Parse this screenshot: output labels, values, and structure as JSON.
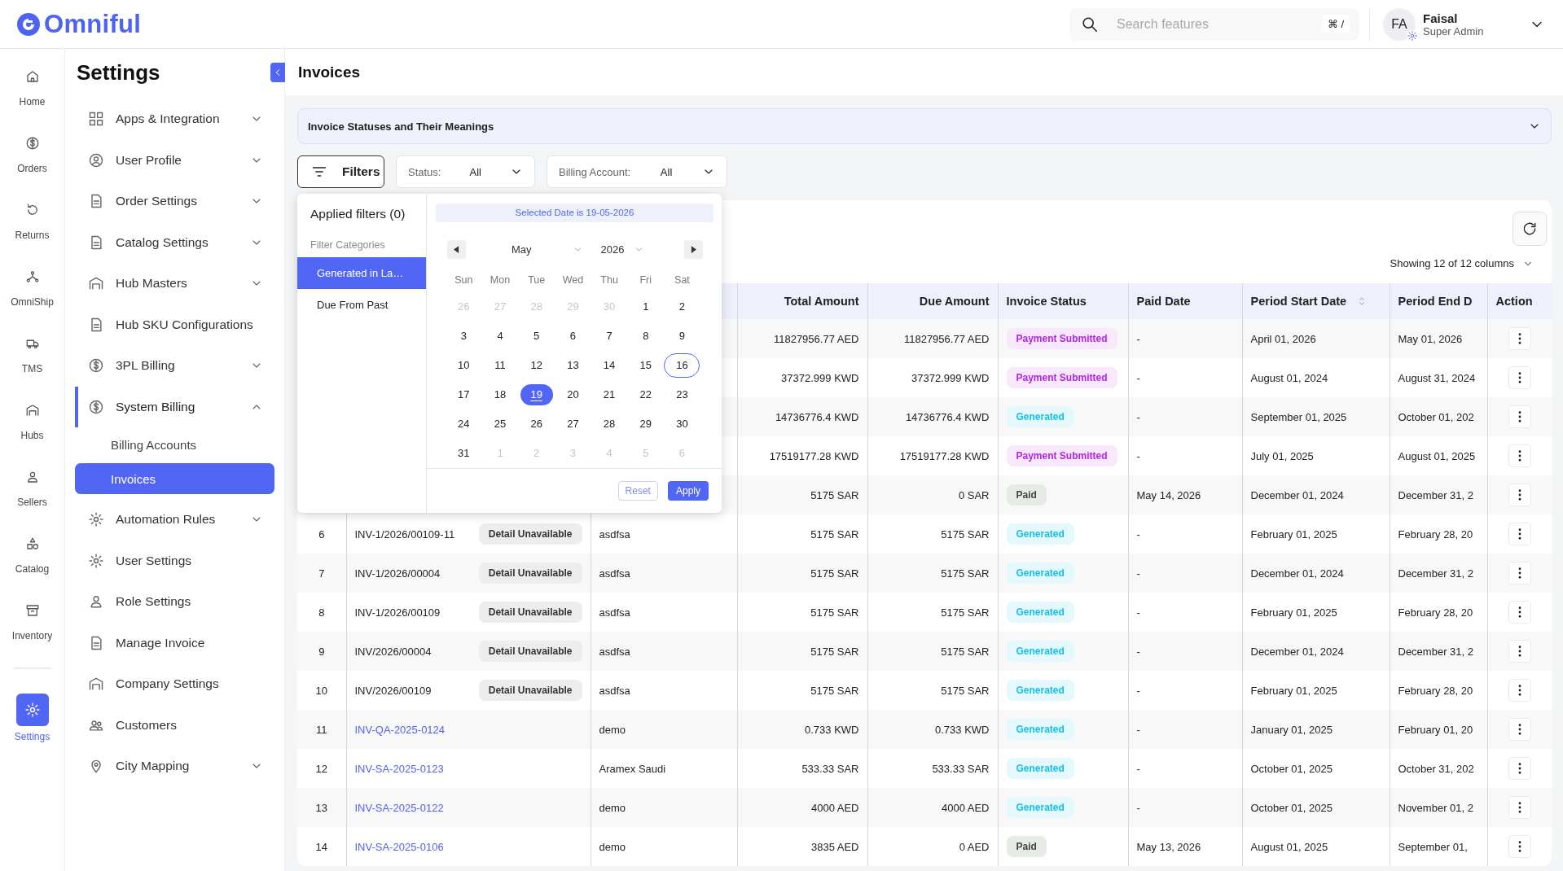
{
  "header": {
    "logo": "Omniful",
    "search": {
      "placeholder": "Search features",
      "shortcut": "⌘ /"
    },
    "user": {
      "initials": "FA",
      "name": "Faisal",
      "role": "Super Admin"
    }
  },
  "rail": {
    "items": [
      {
        "label": "Home",
        "selected": false
      },
      {
        "label": "Orders",
        "selected": false
      },
      {
        "label": "Returns",
        "selected": false
      },
      {
        "label": "OmniShip",
        "selected": false
      },
      {
        "label": "TMS",
        "selected": false
      },
      {
        "label": "Hubs",
        "selected": false
      },
      {
        "label": "Sellers",
        "selected": false
      },
      {
        "label": "Catalog",
        "selected": false
      },
      {
        "label": "Inventory",
        "selected": false
      },
      {
        "label": "Settings",
        "selected": true
      }
    ]
  },
  "settings_panel": {
    "title": "Settings",
    "items": [
      {
        "label": "Apps & Integration",
        "selected": false,
        "expanded": false
      },
      {
        "label": "User Profile",
        "selected": false,
        "expanded": false
      },
      {
        "label": "Order Settings",
        "selected": false,
        "expanded": false
      },
      {
        "label": "Catalog Settings",
        "selected": false,
        "expanded": false
      },
      {
        "label": "Hub Masters",
        "selected": false,
        "expanded": false
      },
      {
        "label": "Hub SKU Configurations",
        "selected": false
      },
      {
        "label": "3PL Billing",
        "selected": false,
        "expanded": false
      },
      {
        "label": "System Billing",
        "selected": true,
        "expanded": true,
        "children": [
          {
            "label": "Billing Accounts",
            "selected": false
          },
          {
            "label": "Invoices",
            "selected": true
          }
        ]
      },
      {
        "label": "Automation Rules",
        "selected": false,
        "expanded": false
      },
      {
        "label": "User Settings",
        "selected": false
      },
      {
        "label": "Role Settings",
        "selected": false
      },
      {
        "label": "Manage Invoice",
        "selected": false
      },
      {
        "label": "Company Settings",
        "selected": false
      },
      {
        "label": "Customers",
        "selected": false
      },
      {
        "label": "City Mapping",
        "selected": false,
        "expanded": false
      }
    ]
  },
  "page_title": "Invoices",
  "accordion": {
    "title": "Invoice Statuses and Their Meanings",
    "expanded": false
  },
  "filter_bar": {
    "button": "Filters",
    "dropdowns": [
      {
        "label": "Status:",
        "value": "All"
      },
      {
        "label": "Billing Account:",
        "value": "All"
      }
    ]
  },
  "filter_popover": {
    "title": "Applied filters (0)",
    "categories_heading": "Filter Categories",
    "categories": [
      {
        "label": "Generated in La…",
        "selected": true
      },
      {
        "label": "Due From Past",
        "selected": false
      }
    ],
    "calendar": {
      "banner": "Selected Date is 19-05-2026",
      "month": "May",
      "year": "2026",
      "weekdays": [
        "Sun",
        "Mon",
        "Tue",
        "Wed",
        "Thu",
        "Fri",
        "Sat"
      ],
      "days": [
        {
          "label": "26",
          "outside": true,
          "selected": false,
          "today": false
        },
        {
          "label": "27",
          "outside": true,
          "selected": false,
          "today": false
        },
        {
          "label": "28",
          "outside": true,
          "selected": false,
          "today": false
        },
        {
          "label": "29",
          "outside": true,
          "selected": false,
          "today": false
        },
        {
          "label": "30",
          "outside": true,
          "selected": false,
          "today": false
        },
        {
          "label": "1",
          "outside": false,
          "selected": false,
          "today": false
        },
        {
          "label": "2",
          "outside": false,
          "selected": false,
          "today": false
        },
        {
          "label": "3",
          "outside": false,
          "selected": false,
          "today": false
        },
        {
          "label": "4",
          "outside": false,
          "selected": false,
          "today": false
        },
        {
          "label": "5",
          "outside": false,
          "selected": false,
          "today": false
        },
        {
          "label": "6",
          "outside": false,
          "selected": false,
          "today": false
        },
        {
          "label": "7",
          "outside": false,
          "selected": false,
          "today": false
        },
        {
          "label": "8",
          "outside": false,
          "selected": false,
          "today": false
        },
        {
          "label": "9",
          "outside": false,
          "selected": false,
          "today": false
        },
        {
          "label": "10",
          "outside": false,
          "selected": false,
          "today": false
        },
        {
          "label": "11",
          "outside": false,
          "selected": false,
          "today": false
        },
        {
          "label": "12",
          "outside": false,
          "selected": false,
          "today": false
        },
        {
          "label": "13",
          "outside": false,
          "selected": false,
          "today": false
        },
        {
          "label": "14",
          "outside": false,
          "selected": false,
          "today": false
        },
        {
          "label": "15",
          "outside": false,
          "selected": false,
          "today": false
        },
        {
          "label": "16",
          "outside": false,
          "selected": false,
          "today": true
        },
        {
          "label": "17",
          "outside": false,
          "selected": false,
          "today": false
        },
        {
          "label": "18",
          "outside": false,
          "selected": false,
          "today": false
        },
        {
          "label": "19",
          "outside": false,
          "selected": true,
          "today": false
        },
        {
          "label": "20",
          "outside": false,
          "selected": false,
          "today": false
        },
        {
          "label": "21",
          "outside": false,
          "selected": false,
          "today": false
        },
        {
          "label": "22",
          "outside": false,
          "selected": false,
          "today": false
        },
        {
          "label": "23",
          "outside": false,
          "selected": false,
          "today": false
        },
        {
          "label": "24",
          "outside": false,
          "selected": false,
          "today": false
        },
        {
          "label": "25",
          "outside": false,
          "selected": false,
          "today": false
        },
        {
          "label": "26",
          "outside": false,
          "selected": false,
          "today": false
        },
        {
          "label": "27",
          "outside": false,
          "selected": false,
          "today": false
        },
        {
          "label": "28",
          "outside": false,
          "selected": false,
          "today": false
        },
        {
          "label": "29",
          "outside": false,
          "selected": false,
          "today": false
        },
        {
          "label": "30",
          "outside": false,
          "selected": false,
          "today": false
        },
        {
          "label": "31",
          "outside": false,
          "selected": false,
          "today": false
        },
        {
          "label": "1",
          "outside": true,
          "selected": false,
          "today": false
        },
        {
          "label": "2",
          "outside": true,
          "selected": false,
          "today": false
        },
        {
          "label": "3",
          "outside": true,
          "selected": false,
          "today": false
        },
        {
          "label": "4",
          "outside": true,
          "selected": false,
          "today": false
        },
        {
          "label": "5",
          "outside": true,
          "selected": false,
          "today": false
        },
        {
          "label": "6",
          "outside": true,
          "selected": false,
          "today": false
        }
      ]
    },
    "reset": {
      "label": "Reset",
      "disabled": true
    },
    "apply": "Apply"
  },
  "table": {
    "columns_info": "Showing 12 of 12 columns",
    "columns": [
      {
        "label": "Total Amount",
        "sortable": false
      },
      {
        "label": "Due Amount",
        "sortable": false
      },
      {
        "label": "Invoice Status",
        "sortable": false
      },
      {
        "label": "Paid Date",
        "sortable": false
      },
      {
        "label": "Period Start Date",
        "sortable": true
      },
      {
        "label": "Period End D",
        "sortable": false
      },
      {
        "label": "Action",
        "sortable": false
      }
    ],
    "rows": [
      {
        "total": "11827956.77 AED",
        "due": "11827956.77 AED",
        "status": {
          "label": "Payment Submitted",
          "kind": "payment_submitted"
        },
        "paid_date": "-",
        "start": "April 01, 2026",
        "end": "May 01, 2026"
      },
      {
        "total": "37372.999 KWD",
        "due": "37372.999 KWD",
        "status": {
          "label": "Payment Submitted",
          "kind": "payment_submitted"
        },
        "paid_date": "-",
        "start": "August 01, 2024",
        "end": "August 31, 2024"
      },
      {
        "total": "14736776.4 KWD",
        "due": "14736776.4 KWD",
        "status": {
          "label": "Generated",
          "kind": "generated"
        },
        "paid_date": "-",
        "start": "September 01, 2025",
        "end": "October 01, 202"
      },
      {
        "total": "17519177.28 KWD",
        "due": "17519177.28 KWD",
        "status": {
          "label": "Payment Submitted",
          "kind": "payment_submitted"
        },
        "paid_date": "-",
        "start": "July 01, 2025",
        "end": "August 01, 2025"
      },
      {
        "total": "5175 SAR",
        "due": "0 SAR",
        "status": {
          "label": "Paid",
          "kind": "paid"
        },
        "paid_date": "May 14, 2026",
        "start": "December 01, 2024",
        "end": "December 31, 2"
      },
      {
        "number": "6",
        "invoice": "INV-1/2026/00109-11",
        "link": false,
        "detail": "Detail Unavailable",
        "account": "asdfsa",
        "total": "5175 SAR",
        "due": "5175 SAR",
        "status": {
          "label": "Generated",
          "kind": "generated"
        },
        "paid_date": "-",
        "start": "February 01, 2025",
        "end": "February 28, 20"
      },
      {
        "number": "7",
        "invoice": "INV-1/2026/00004",
        "link": false,
        "detail": "Detail Unavailable",
        "account": "asdfsa",
        "total": "5175 SAR",
        "due": "5175 SAR",
        "status": {
          "label": "Generated",
          "kind": "generated"
        },
        "paid_date": "-",
        "start": "December 01, 2024",
        "end": "December 31, 2"
      },
      {
        "number": "8",
        "invoice": "INV-1/2026/00109",
        "link": false,
        "detail": "Detail Unavailable",
        "account": "asdfsa",
        "total": "5175 SAR",
        "due": "5175 SAR",
        "status": {
          "label": "Generated",
          "kind": "generated"
        },
        "paid_date": "-",
        "start": "February 01, 2025",
        "end": "February 28, 20"
      },
      {
        "number": "9",
        "invoice": "INV/2026/00004",
        "link": false,
        "detail": "Detail Unavailable",
        "account": "asdfsa",
        "total": "5175 SAR",
        "due": "5175 SAR",
        "status": {
          "label": "Generated",
          "kind": "generated"
        },
        "paid_date": "-",
        "start": "December 01, 2024",
        "end": "December 31, 2"
      },
      {
        "number": "10",
        "invoice": "INV/2026/00109",
        "link": false,
        "detail": "Detail Unavailable",
        "account": "asdfsa",
        "total": "5175 SAR",
        "due": "5175 SAR",
        "status": {
          "label": "Generated",
          "kind": "generated"
        },
        "paid_date": "-",
        "start": "February 01, 2025",
        "end": "February 28, 20"
      },
      {
        "number": "11",
        "invoice": "INV-QA-2025-0124",
        "link": true,
        "account": "demo",
        "total": "0.733 KWD",
        "due": "0.733 KWD",
        "status": {
          "label": "Generated",
          "kind": "generated"
        },
        "paid_date": "-",
        "start": "January 01, 2025",
        "end": "February 01, 20"
      },
      {
        "number": "12",
        "invoice": "INV-SA-2025-0123",
        "link": true,
        "account": "Aramex Saudi",
        "total": "533.33 SAR",
        "due": "533.33 SAR",
        "status": {
          "label": "Generated",
          "kind": "generated"
        },
        "paid_date": "-",
        "start": "October 01, 2025",
        "end": "October 31, 202"
      },
      {
        "number": "13",
        "invoice": "INV-SA-2025-0122",
        "link": true,
        "account": "demo",
        "total": "4000 AED",
        "due": "4000 AED",
        "status": {
          "label": "Generated",
          "kind": "generated"
        },
        "paid_date": "-",
        "start": "October 01, 2025",
        "end": "November 01, 2"
      },
      {
        "number": "14",
        "invoice": "INV-SA-2025-0106",
        "link": true,
        "account": "demo",
        "total": "3835 AED",
        "due": "0 AED",
        "status": {
          "label": "Paid",
          "kind": "paid"
        },
        "paid_date": "May 13, 2026",
        "start": "August 01, 2025",
        "end": "September 01,"
      }
    ]
  }
}
